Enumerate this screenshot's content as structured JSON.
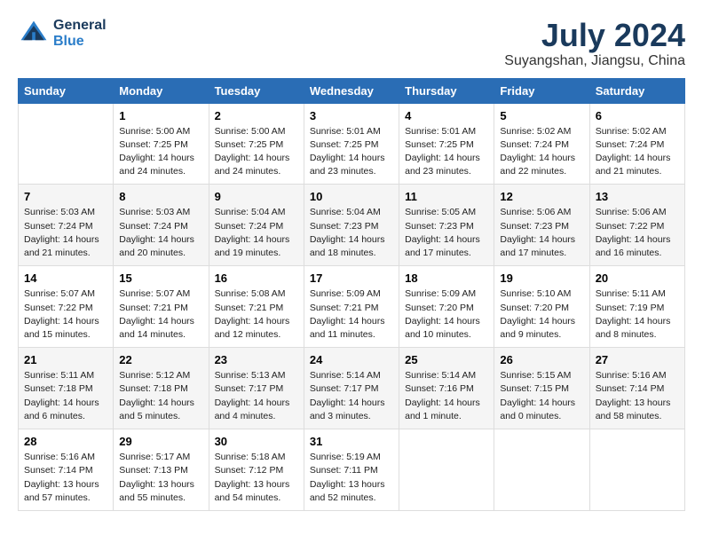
{
  "header": {
    "logo_line1": "General",
    "logo_line2": "Blue",
    "month_year": "July 2024",
    "location": "Suyangshan, Jiangsu, China"
  },
  "weekdays": [
    "Sunday",
    "Monday",
    "Tuesday",
    "Wednesday",
    "Thursday",
    "Friday",
    "Saturday"
  ],
  "rows": [
    [
      {
        "day": "",
        "info": ""
      },
      {
        "day": "1",
        "info": "Sunrise: 5:00 AM\nSunset: 7:25 PM\nDaylight: 14 hours\nand 24 minutes."
      },
      {
        "day": "2",
        "info": "Sunrise: 5:00 AM\nSunset: 7:25 PM\nDaylight: 14 hours\nand 24 minutes."
      },
      {
        "day": "3",
        "info": "Sunrise: 5:01 AM\nSunset: 7:25 PM\nDaylight: 14 hours\nand 23 minutes."
      },
      {
        "day": "4",
        "info": "Sunrise: 5:01 AM\nSunset: 7:25 PM\nDaylight: 14 hours\nand 23 minutes."
      },
      {
        "day": "5",
        "info": "Sunrise: 5:02 AM\nSunset: 7:24 PM\nDaylight: 14 hours\nand 22 minutes."
      },
      {
        "day": "6",
        "info": "Sunrise: 5:02 AM\nSunset: 7:24 PM\nDaylight: 14 hours\nand 21 minutes."
      }
    ],
    [
      {
        "day": "7",
        "info": "Sunrise: 5:03 AM\nSunset: 7:24 PM\nDaylight: 14 hours\nand 21 minutes."
      },
      {
        "day": "8",
        "info": "Sunrise: 5:03 AM\nSunset: 7:24 PM\nDaylight: 14 hours\nand 20 minutes."
      },
      {
        "day": "9",
        "info": "Sunrise: 5:04 AM\nSunset: 7:24 PM\nDaylight: 14 hours\nand 19 minutes."
      },
      {
        "day": "10",
        "info": "Sunrise: 5:04 AM\nSunset: 7:23 PM\nDaylight: 14 hours\nand 18 minutes."
      },
      {
        "day": "11",
        "info": "Sunrise: 5:05 AM\nSunset: 7:23 PM\nDaylight: 14 hours\nand 17 minutes."
      },
      {
        "day": "12",
        "info": "Sunrise: 5:06 AM\nSunset: 7:23 PM\nDaylight: 14 hours\nand 17 minutes."
      },
      {
        "day": "13",
        "info": "Sunrise: 5:06 AM\nSunset: 7:22 PM\nDaylight: 14 hours\nand 16 minutes."
      }
    ],
    [
      {
        "day": "14",
        "info": "Sunrise: 5:07 AM\nSunset: 7:22 PM\nDaylight: 14 hours\nand 15 minutes."
      },
      {
        "day": "15",
        "info": "Sunrise: 5:07 AM\nSunset: 7:21 PM\nDaylight: 14 hours\nand 14 minutes."
      },
      {
        "day": "16",
        "info": "Sunrise: 5:08 AM\nSunset: 7:21 PM\nDaylight: 14 hours\nand 12 minutes."
      },
      {
        "day": "17",
        "info": "Sunrise: 5:09 AM\nSunset: 7:21 PM\nDaylight: 14 hours\nand 11 minutes."
      },
      {
        "day": "18",
        "info": "Sunrise: 5:09 AM\nSunset: 7:20 PM\nDaylight: 14 hours\nand 10 minutes."
      },
      {
        "day": "19",
        "info": "Sunrise: 5:10 AM\nSunset: 7:20 PM\nDaylight: 14 hours\nand 9 minutes."
      },
      {
        "day": "20",
        "info": "Sunrise: 5:11 AM\nSunset: 7:19 PM\nDaylight: 14 hours\nand 8 minutes."
      }
    ],
    [
      {
        "day": "21",
        "info": "Sunrise: 5:11 AM\nSunset: 7:18 PM\nDaylight: 14 hours\nand 6 minutes."
      },
      {
        "day": "22",
        "info": "Sunrise: 5:12 AM\nSunset: 7:18 PM\nDaylight: 14 hours\nand 5 minutes."
      },
      {
        "day": "23",
        "info": "Sunrise: 5:13 AM\nSunset: 7:17 PM\nDaylight: 14 hours\nand 4 minutes."
      },
      {
        "day": "24",
        "info": "Sunrise: 5:14 AM\nSunset: 7:17 PM\nDaylight: 14 hours\nand 3 minutes."
      },
      {
        "day": "25",
        "info": "Sunrise: 5:14 AM\nSunset: 7:16 PM\nDaylight: 14 hours\nand 1 minute."
      },
      {
        "day": "26",
        "info": "Sunrise: 5:15 AM\nSunset: 7:15 PM\nDaylight: 14 hours\nand 0 minutes."
      },
      {
        "day": "27",
        "info": "Sunrise: 5:16 AM\nSunset: 7:14 PM\nDaylight: 13 hours\nand 58 minutes."
      }
    ],
    [
      {
        "day": "28",
        "info": "Sunrise: 5:16 AM\nSunset: 7:14 PM\nDaylight: 13 hours\nand 57 minutes."
      },
      {
        "day": "29",
        "info": "Sunrise: 5:17 AM\nSunset: 7:13 PM\nDaylight: 13 hours\nand 55 minutes."
      },
      {
        "day": "30",
        "info": "Sunrise: 5:18 AM\nSunset: 7:12 PM\nDaylight: 13 hours\nand 54 minutes."
      },
      {
        "day": "31",
        "info": "Sunrise: 5:19 AM\nSunset: 7:11 PM\nDaylight: 13 hours\nand 52 minutes."
      },
      {
        "day": "",
        "info": ""
      },
      {
        "day": "",
        "info": ""
      },
      {
        "day": "",
        "info": ""
      }
    ]
  ]
}
